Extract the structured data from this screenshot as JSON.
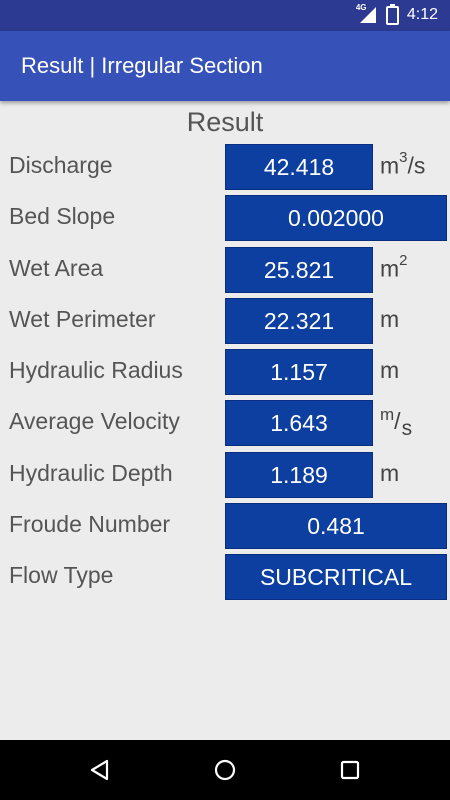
{
  "status": {
    "network": "4G",
    "time": "4:12"
  },
  "appbar": {
    "title": "Result | Irregular Section"
  },
  "heading": "Result",
  "rows": [
    {
      "label": "Discharge",
      "value": "42.418",
      "unit_base": "m",
      "unit_sup": "3",
      "unit_tail": "/s"
    },
    {
      "label": "Bed Slope",
      "value": "0.002000"
    },
    {
      "label": "Wet Area",
      "value": "25.821",
      "unit_base": "m",
      "unit_sup": "2"
    },
    {
      "label": "Wet Perimeter",
      "value": "22.321",
      "unit": "m"
    },
    {
      "label": "Hydraulic Radius",
      "value": "1.157",
      "unit": "m"
    },
    {
      "label": "Average Velocity",
      "value": "1.643",
      "unit_num": "m",
      "unit_slash": "/",
      "unit_den": "s"
    },
    {
      "label": "Hydraulic Depth",
      "value": "1.189",
      "unit": "m"
    },
    {
      "label": "Froude Number",
      "value": "0.481"
    },
    {
      "label": "Flow Type",
      "value": "SUBCRITICAL"
    }
  ],
  "colors": {
    "statusbar": "#2d3a91",
    "appbar": "#3651b8",
    "value_box": "#0d3fa0",
    "background": "#ececec"
  },
  "nav": {
    "back": "back-icon",
    "home": "home-icon",
    "recent": "recent-apps-icon"
  }
}
